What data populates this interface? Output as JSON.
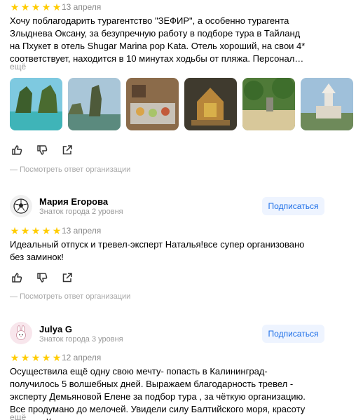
{
  "review1": {
    "date": "13 апреля",
    "text": "Хочу поблагодарить турагентство \"ЗЕФИР\", а особенно турагента Злыднева Оксану, за безупречную работу в подборе тура в Тайланд на Пхукет в отель Shugar Marina pop Kata. Отель хороший, на свои 4* соответствует, находится в 10 минутах ходьбы от пляжа. Персонал…",
    "more": "ещё",
    "org_reply": "— Посмотреть ответ организации"
  },
  "review2": {
    "name": "Мария Егорова",
    "level": "Знаток города 2 уровня",
    "subscribe": "Подписаться",
    "date": "13 апреля",
    "text": "Идеальный отпуск и тревел-эксперт Наталья!все супер организовано без заминок!",
    "org_reply": "— Посмотреть ответ организации"
  },
  "review3": {
    "name": "Julya G",
    "level": "Знаток города 3 уровня",
    "subscribe": "Подписаться",
    "date": "12 апреля",
    "text": "Осуществила ещё одну свою мечту- попасть в Калининград- получилось 5 волшебных дней. Выражаем благодарность тревел - эксперту Демьяновой Елене за подбор тура , за чёткую организацию. Все продумано до мелочей. Увидели силу Балтийского моря, красоту острова Канта и…",
    "more": "ещё"
  },
  "rating": 5,
  "colors": {
    "star": "#ffcc00",
    "link": "#1d6fe8",
    "subscribe_bg": "#eef4ff",
    "muted": "#999999"
  },
  "icons": [
    "star-icon",
    "thumbs-up-icon",
    "thumbs-down-icon",
    "share-icon",
    "soccer-ball-avatar-icon",
    "bunny-avatar-icon"
  ]
}
